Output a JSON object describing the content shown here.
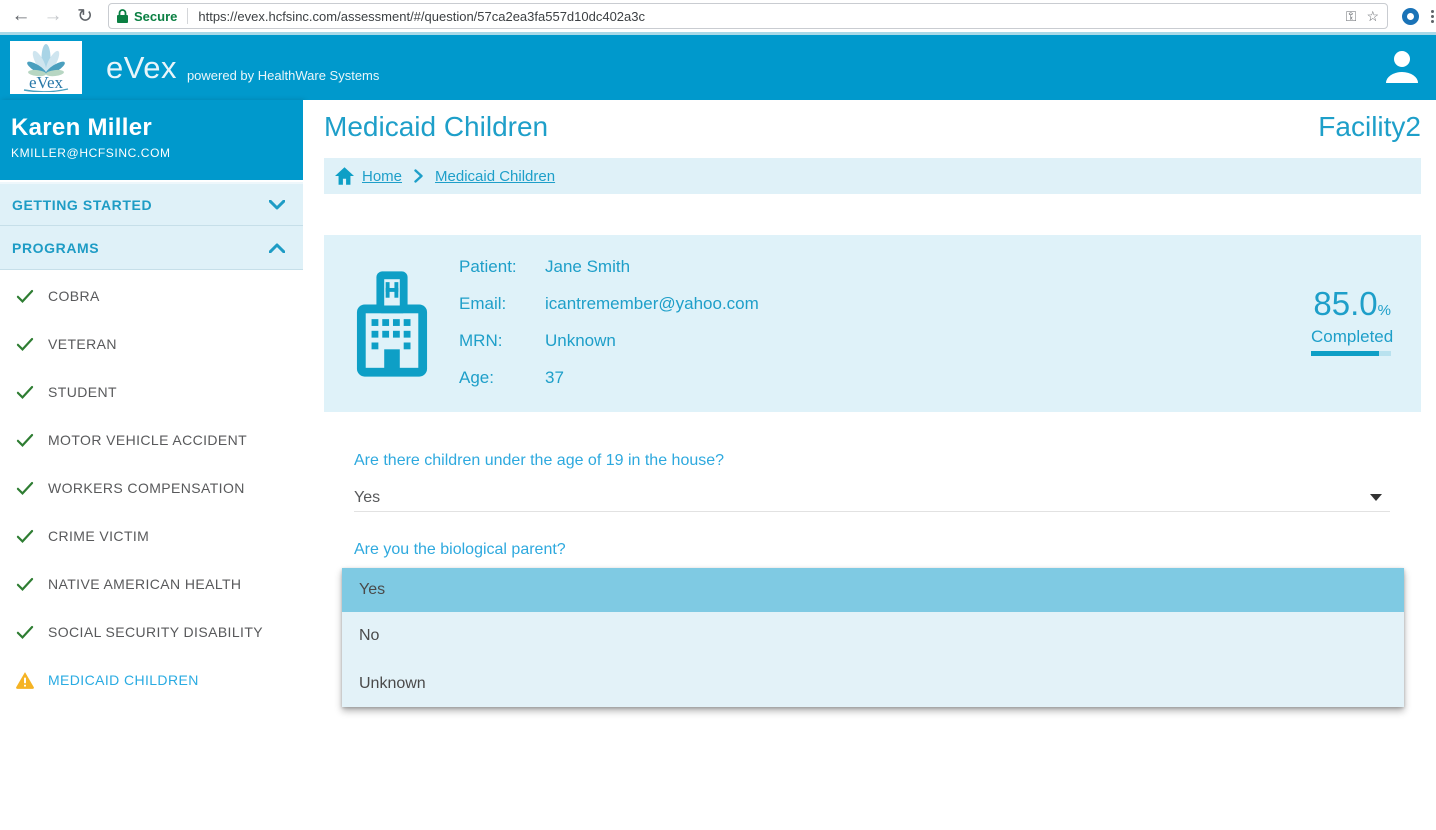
{
  "browser": {
    "security_label": "Secure",
    "url": "https://evex.hcfsinc.com/assessment/#/question/57ca2ea3fa557d10dc402a3c"
  },
  "header": {
    "logo_text": "eVex",
    "app_name": "eVex",
    "tagline": "powered by HealthWare Systems"
  },
  "sidebar": {
    "user": {
      "name": "Karen Miller",
      "email": "KMILLER@HCFSINC.COM"
    },
    "sections": [
      {
        "label": "GETTING STARTED",
        "state": "collapsed"
      },
      {
        "label": "PROGRAMS",
        "state": "expanded"
      }
    ],
    "programs": [
      {
        "label": "COBRA",
        "status": "complete"
      },
      {
        "label": "VETERAN",
        "status": "complete"
      },
      {
        "label": "STUDENT",
        "status": "complete"
      },
      {
        "label": "MOTOR VEHICLE ACCIDENT",
        "status": "complete"
      },
      {
        "label": "WORKERS COMPENSATION",
        "status": "complete"
      },
      {
        "label": "CRIME VICTIM",
        "status": "complete"
      },
      {
        "label": "NATIVE AMERICAN HEALTH",
        "status": "complete"
      },
      {
        "label": "SOCIAL SECURITY DISABILITY",
        "status": "complete"
      },
      {
        "label": "MEDICAID CHILDREN",
        "status": "warning",
        "active": true
      }
    ]
  },
  "main": {
    "title": "Medicaid Children",
    "facility": "Facility2",
    "breadcrumb": {
      "home": "Home",
      "current": "Medicaid Children"
    },
    "patient": {
      "patient_label": "Patient:",
      "patient_value": "Jane Smith",
      "email_label": "Email:",
      "email_value": "icantremember@yahoo.com",
      "mrn_label": "MRN:",
      "mrn_value": "Unknown",
      "age_label": "Age:",
      "age_value": "37"
    },
    "progress": {
      "percent": "85.0",
      "percent_sign": "%",
      "label": "Completed",
      "fraction": 0.85
    },
    "question_children": {
      "text": "Are there children under the age of 19 in the house?",
      "value": "Yes"
    },
    "question_parent": {
      "text": "Are you the biological parent?",
      "options": [
        "Yes",
        "No",
        "Unknown"
      ],
      "highlighted": "Yes"
    }
  },
  "colors": {
    "accent_teal": "#0099cc",
    "text_teal": "#1e9fc9",
    "question_blue": "#2ea9de",
    "active_link_blue": "#29abe2",
    "light_panel": "#dff1f8",
    "dropdown_bg": "#e3f2f8",
    "dropdown_highlight": "#7fcae3",
    "check_green": "#2e7d32",
    "warning_amber": "#f5b324",
    "secure_green": "#0b8043"
  }
}
